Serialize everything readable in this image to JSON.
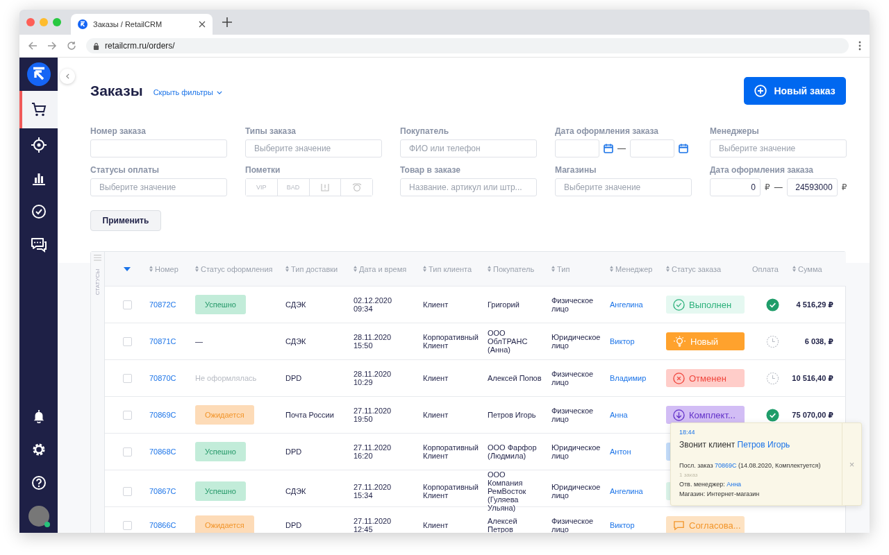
{
  "browser": {
    "tab_title": "Заказы / RetailCRM",
    "url": "retailcrm.ru/orders/"
  },
  "sidebar": {
    "items": [
      {
        "kind": "cart",
        "selected": true
      },
      {
        "kind": "target",
        "selected": false
      },
      {
        "kind": "chart",
        "selected": false
      },
      {
        "kind": "tasks",
        "selected": false
      },
      {
        "kind": "chat",
        "selected": false
      }
    ],
    "bottom_items": [
      {
        "kind": "bell"
      },
      {
        "kind": "settings"
      },
      {
        "kind": "help"
      },
      {
        "kind": "avatar",
        "online": true
      }
    ]
  },
  "header": {
    "title": "Заказы",
    "filters_toggle": "Скрыть фильтры",
    "new_button": "Новый заказ"
  },
  "filters": [
    {
      "label": "Номер заказа",
      "kind": "text"
    },
    {
      "label": "Типы заказа",
      "kind": "select",
      "placeholder": "Выберите значение"
    },
    {
      "label": "Покупатель",
      "kind": "text",
      "placeholder": "ФИО или телефон"
    },
    {
      "label": "Дата оформления заказа",
      "kind": "date_range",
      "separator": "—"
    },
    {
      "label": "Менеджеры",
      "kind": "select",
      "placeholder": "Выберите значение"
    },
    {
      "label": "Статусы оплаты",
      "kind": "select",
      "placeholder": "Выберите значение"
    },
    {
      "label": "Пометки",
      "kind": "tags",
      "tags": [
        {
          "kind": "text",
          "text": "VIP",
          "selected": false
        },
        {
          "kind": "text",
          "text": "BAD",
          "selected": false
        },
        {
          "kind": "flag",
          "selected": false
        },
        {
          "kind": "alarm",
          "selected": false
        }
      ]
    },
    {
      "label": "Товар в заказе",
      "kind": "text",
      "placeholder": "Название. артикул или штр..."
    },
    {
      "label": "Магазины",
      "kind": "select",
      "placeholder": "Выберите значение"
    },
    {
      "label": "Дата оформления заказа",
      "kind": "number_range",
      "from": "0",
      "to": "24593000",
      "currency": "₽",
      "separator": "—"
    }
  ],
  "apply_button": "Применить",
  "table": {
    "side_label": "СТАТУСЫ",
    "columns": [
      {
        "label": "Номер",
        "sortable": true
      },
      {
        "label": "Статус оформления",
        "sortable": true
      },
      {
        "label": "Тип доставки",
        "sortable": true
      },
      {
        "label": "Дата и время",
        "sortable": true
      },
      {
        "label": "Тип клиента",
        "sortable": true
      },
      {
        "label": "Покупатель",
        "sortable": true
      },
      {
        "label": "Тип",
        "sortable": true
      },
      {
        "label": "Менеджер",
        "sortable": true
      },
      {
        "label": "Статус заказа",
        "sortable": true
      },
      {
        "label": "Оплата",
        "sortable": false
      },
      {
        "label": "Сумма",
        "sortable": true
      }
    ],
    "rows": [
      {
        "checked": false,
        "number": "70872C",
        "registration": {
          "kind": "success",
          "text": "Успешно"
        },
        "delivery": "СДЭК",
        "date": "02.12.2020",
        "time": "09:34",
        "client_type": "Клиент",
        "buyer": "Григорий",
        "type": "Физическое лицо",
        "manager": "Ангелина",
        "status": {
          "kind": "done",
          "text": "Выполнен"
        },
        "payment": {
          "kind": "paid"
        },
        "sum": "4 516,29 ₽"
      },
      {
        "checked": false,
        "number": "70871C",
        "registration": {
          "kind": "none",
          "text": "—"
        },
        "delivery": "СДЭК",
        "date": "28.11.2020",
        "time": "15:50",
        "client_type": "Корпоративный Клиент",
        "buyer": "ООО ОблТРАНС (Анна)",
        "type": "Юридическое лицо",
        "manager": "Виктор",
        "status": {
          "kind": "new",
          "text": "Новый"
        },
        "payment": {
          "kind": "pending"
        },
        "sum": "6 038, ₽"
      },
      {
        "checked": false,
        "number": "70870C",
        "registration": {
          "kind": "missing",
          "text": "Не оформлялась"
        },
        "delivery": "DPD",
        "date": "28.11.2020",
        "time": "10:29",
        "client_type": "Клиент",
        "buyer": "Алексей Попов",
        "type": "Физическое лицо",
        "manager": "Владимир",
        "status": {
          "kind": "cancelled",
          "text": "Отменен"
        },
        "payment": {
          "kind": "pending"
        },
        "sum": "10 516,40 ₽"
      },
      {
        "checked": false,
        "number": "70869C",
        "registration": {
          "kind": "waiting",
          "text": "Ожидается"
        },
        "delivery": "Почта России",
        "date": "27.11.2020",
        "time": "19:50",
        "client_type": "Клиент",
        "buyer": "Петров Игорь",
        "type": "Физическое лицо",
        "manager": "Анна",
        "status": {
          "kind": "assembling",
          "text": "Комплект..."
        },
        "payment": {
          "kind": "paid"
        },
        "sum": "75 070,00 ₽"
      },
      {
        "checked": false,
        "number": "70868C",
        "registration": {
          "kind": "success",
          "text": "Успешно"
        },
        "delivery": "DPD",
        "date": "27.11.2020",
        "time": "16:20",
        "client_type": "Корпоративный Клиент",
        "buyer": "ООО Фарфор (Людмила)",
        "type": "Юридическое лицо",
        "manager": "Антон",
        "status": {
          "kind": "covered_blue"
        }
      },
      {
        "checked": false,
        "number": "70867C",
        "registration": {
          "kind": "success",
          "text": "Успешно"
        },
        "delivery": "СДЭК",
        "date": "27.11.2020",
        "time": "15:34",
        "client_type": "Корпоративный Клиент",
        "buyer": "ООО Компания РемВосток (Гуляева Ульяна)",
        "type": "Юридическое лицо",
        "manager": "Ангелина",
        "status": {
          "kind": "covered_green"
        }
      },
      {
        "checked": false,
        "number": "70866C",
        "registration": {
          "kind": "waiting",
          "text": "Ожидается"
        },
        "delivery": "DPD",
        "date": "27.11.2020",
        "time": "12:45",
        "client_type": "Клиент",
        "buyer": "Алексей Петров",
        "type": "Физическое лицо",
        "manager": "Виктор",
        "status": {
          "kind": "approval",
          "text": "Согласова..."
        }
      }
    ]
  },
  "call_popup": {
    "time": "18:44",
    "title": "Звонит клиент",
    "client": "Петров Игорь",
    "last_order_label": "Посл. заказ",
    "last_order_number": "70869C",
    "last_order_details": "(14.08.2020, Комплектуется)",
    "order_count": "1 заказ",
    "manager_label": "Отв. менеджер:",
    "manager": "Анна",
    "shop": "Магазин: Интернет-магазин",
    "close": "×"
  }
}
